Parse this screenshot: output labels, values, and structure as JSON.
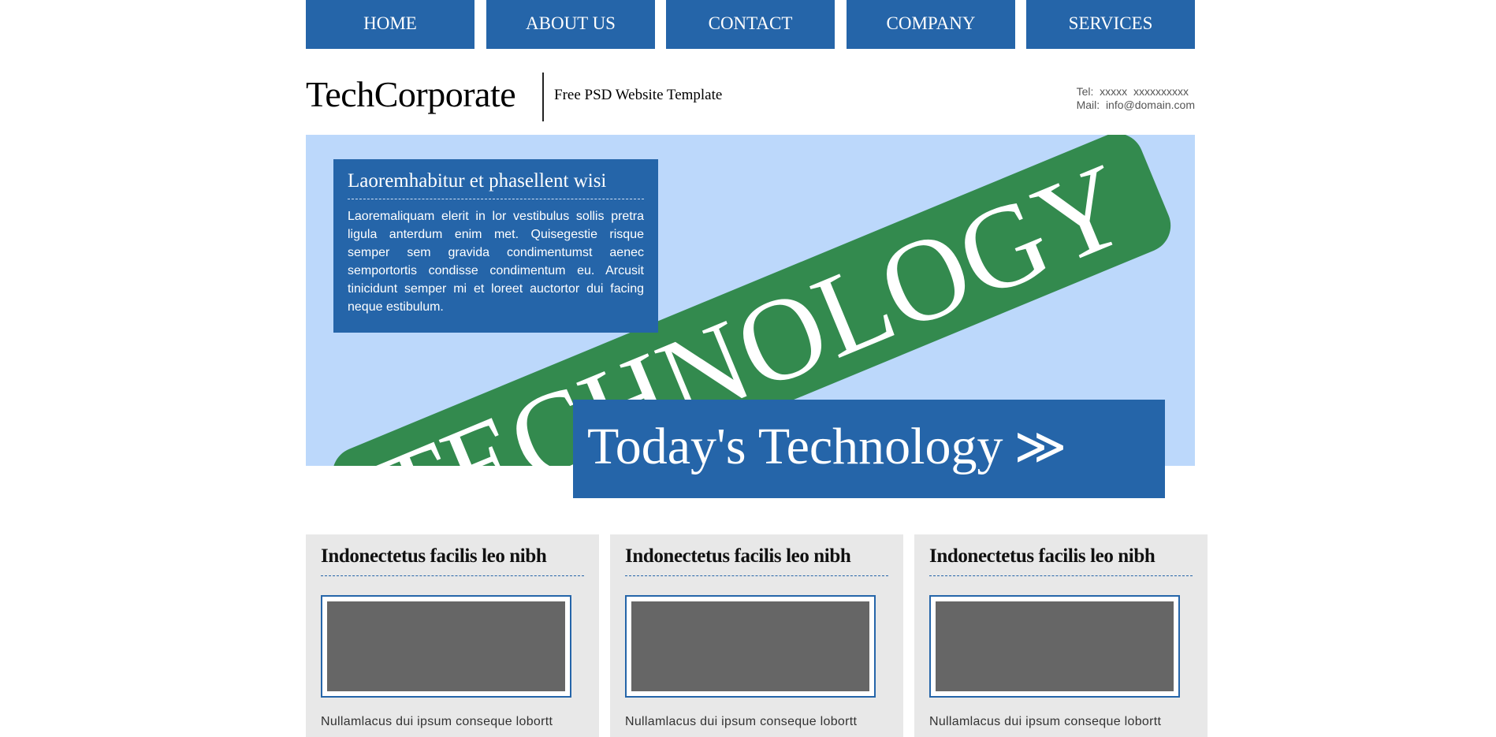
{
  "nav": {
    "items": [
      {
        "label": "HOME"
      },
      {
        "label": "ABOUT US"
      },
      {
        "label": "CONTACT"
      },
      {
        "label": "COMPANY"
      },
      {
        "label": "SERVICES"
      }
    ]
  },
  "header": {
    "brand": "TechCorporate",
    "tagline": "Free PSD Website Template",
    "tel": "Tel:  xxxxx  xxxxxxxxxx",
    "mail": "Mail:  info@domain.com"
  },
  "hero": {
    "banner_word": "TECHNOLOGY",
    "box_title": "Laoremhabitur et phasellent wisi",
    "box_text": "Laoremaliquam elerit in lor vestibulus sollis pretra ligula anterdum enim met. Quisegestie risque semper sem gravida condimentumst aenec semportortis condisse condimentum eu. Arcusit tinicidunt semper mi et loreet auctortor dui facing neque estibulum.",
    "cta_label": "Today's Technology",
    "cta_arrow": "≫",
    "colors": {
      "background": "#bcd8fb",
      "banner": "#338a4e",
      "panel": "#2565a9"
    }
  },
  "cards": [
    {
      "title": "Indonectetus facilis leo nibh",
      "text": "Nullamlacus dui ipsum conseque lobortt"
    },
    {
      "title": "Indonectetus facilis leo nibh",
      "text": "Nullamlacus dui ipsum conseque lobortt"
    },
    {
      "title": "Indonectetus facilis leo nibh",
      "text": "Nullamlacus dui ipsum conseque lobortt"
    }
  ]
}
